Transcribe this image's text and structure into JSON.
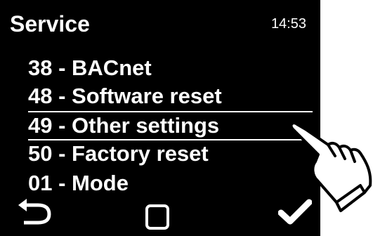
{
  "header": {
    "title": "Service",
    "clock": "14:53"
  },
  "menu": {
    "items": [
      {
        "label": "38 - BACnet"
      },
      {
        "label": "48 - Software reset"
      },
      {
        "label": "49 - Other settings",
        "selected": true
      },
      {
        "label": "50 - Factory reset"
      },
      {
        "label": "01 - Mode"
      }
    ]
  },
  "footer": {
    "back_icon": "back-arrow-icon",
    "home_icon": "square-icon",
    "ok_icon": "checkmark-icon"
  },
  "colors": {
    "background": "#000000",
    "foreground": "#ffffff"
  }
}
